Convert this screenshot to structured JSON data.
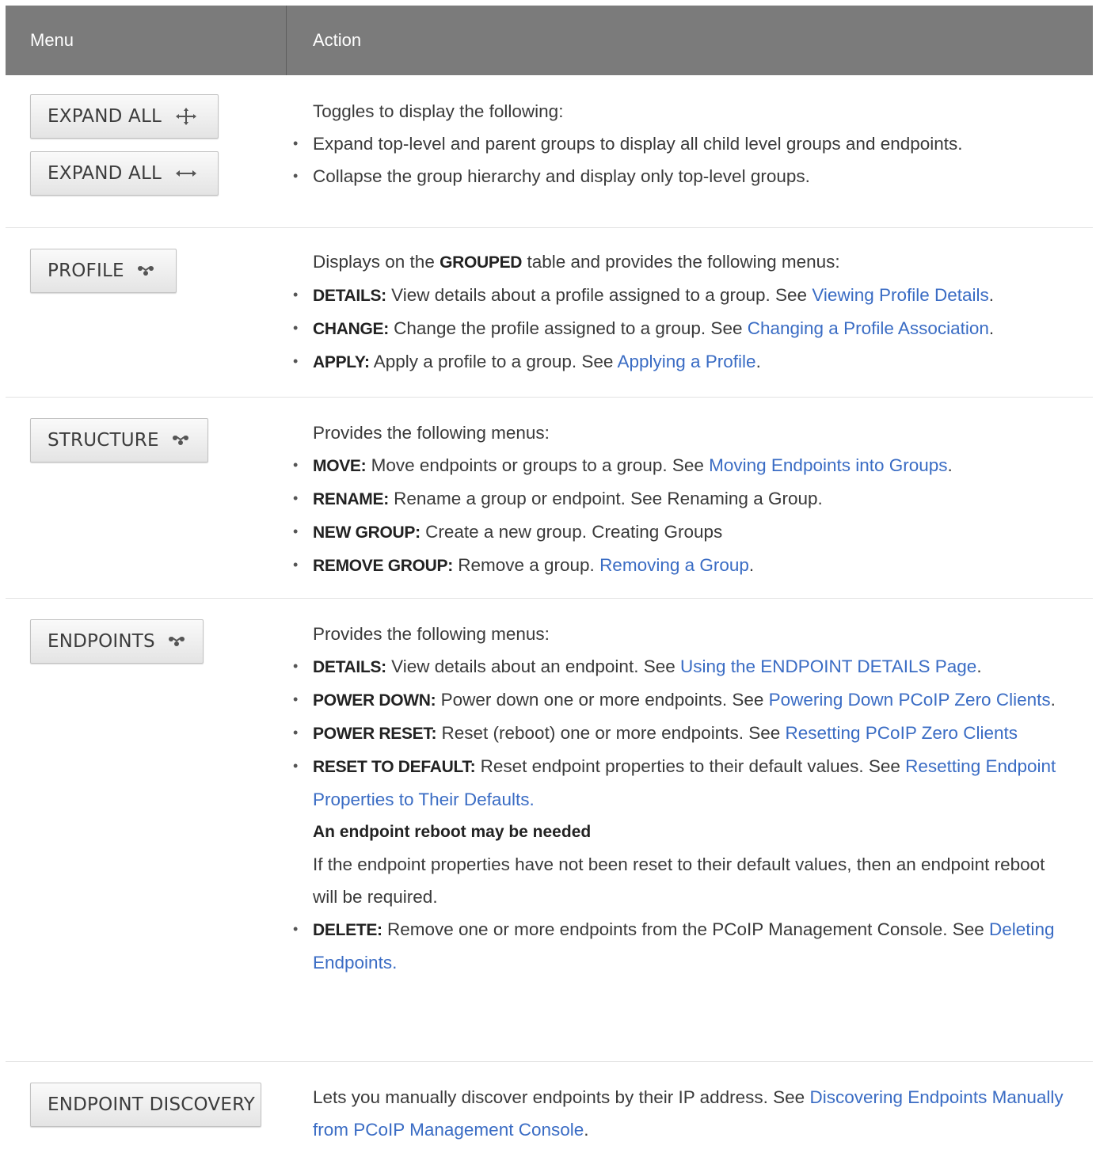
{
  "header": {
    "menu": "Menu",
    "action": "Action"
  },
  "rows": {
    "expand": {
      "btn1": "EXPAND ALL",
      "btn2": "EXPAND ALL",
      "intro": "Toggles to display the following:",
      "items": [
        "Expand top-level and parent groups to display all child level groups and endpoints.",
        "Collapse the group hierarchy and display only top-level groups."
      ]
    },
    "profile": {
      "btn": "PROFILE",
      "intro_pre": "Displays on the ",
      "intro_key": "GROUPED",
      "intro_post": " table and provides the following menus:",
      "items": [
        {
          "key": "DETAILS:",
          "text": " View details about a profile assigned to a group. See ",
          "link": "Viewing Profile Details",
          "tail": "."
        },
        {
          "key": "CHANGE:",
          "text": " Change the profile assigned to a group. See ",
          "link": "Changing a Profile Association",
          "tail": "."
        },
        {
          "key": "APPLY:",
          "text": " Apply a profile to a group. See ",
          "link": "Applying a Profile",
          "tail": "."
        }
      ]
    },
    "structure": {
      "btn": "STRUCTURE",
      "intro": "Provides the following menus:",
      "items": [
        {
          "key": "MOVE:",
          "text": " Move endpoints or groups to a group. See ",
          "link": "Moving Endpoints into Groups",
          "tail": "."
        },
        {
          "key": "RENAME:",
          "text": " Rename a group or endpoint. See Renaming a Group.",
          "link": "",
          "tail": ""
        },
        {
          "key": "NEW GROUP:",
          "text": " Create a new group. Creating Groups",
          "link": "",
          "tail": ""
        },
        {
          "key": "REMOVE GROUP:",
          "text": " Remove a group. ",
          "link": "Removing a Group",
          "tail": "."
        }
      ]
    },
    "endpoints": {
      "btn": "ENDPOINTS",
      "intro": "Provides the following menus:",
      "items": [
        {
          "key": "DETAILS:",
          "text": " View details about an endpoint. See ",
          "link": "Using the ENDPOINT DETAILS Page",
          "tail": "."
        },
        {
          "key": "POWER DOWN:",
          "text": " Power down one or more endpoints. See ",
          "link": "Powering Down PCoIP Zero Clients",
          "tail": "."
        },
        {
          "key": "POWER RESET:",
          "text": " Reset (reboot) one or more endpoints. See ",
          "link": "Resetting PCoIP Zero Clients",
          "tail": ""
        },
        {
          "key": "RESET TO DEFAULT:",
          "text": " Reset endpoint properties to their default values. See ",
          "link": "Resetting Endpoint Properties to Their Defaults.",
          "tail": ""
        }
      ],
      "note_title": "An endpoint reboot may be needed",
      "note_text": "If the endpoint properties have not been reset to their default values, then an endpoint reboot will be required.",
      "last": {
        "key": "DELETE:",
        "text": " Remove one or more endpoints from the PCoIP Management Console. See ",
        "link": "Deleting Endpoints.",
        "tail": ""
      }
    },
    "discovery": {
      "btn": "ENDPOINT DISCOVERY",
      "text": "Lets you manually discover endpoints by their IP address. See ",
      "link": "Discovering Endpoints Manually from PCoIP Management Console",
      "tail": "."
    }
  },
  "icons": {
    "expand": "four-way-arrow-icon",
    "collapse": "collapse-arrows-icon",
    "dropdown": "chevron-down-icon"
  }
}
